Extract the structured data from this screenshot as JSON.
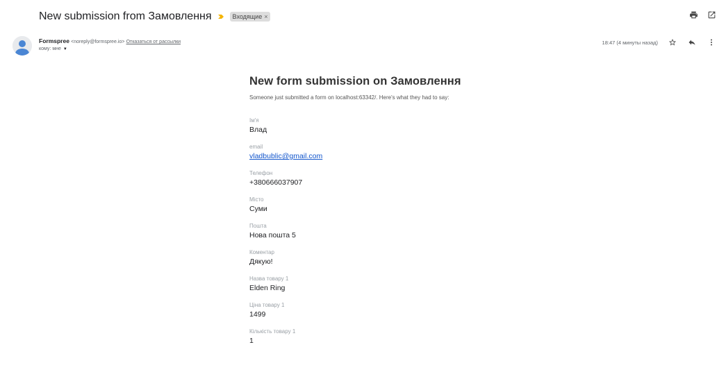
{
  "email": {
    "subject": "New submission from Замовлення",
    "label": "Входящие",
    "label_remove": "×",
    "sender_name": "Formspree",
    "sender_email": "<noreply@formspree.io>",
    "unsubscribe": "Отказаться от рассылки",
    "to": "кому: мне",
    "time": "18:47 (4 минуты назад)"
  },
  "content": {
    "title": "New form submission on Замовлення",
    "intro": "Someone just submitted a form on localhost:63342/. Here's what they had to say:",
    "fields": [
      {
        "label": "Ім'я",
        "value": "Влад"
      },
      {
        "label": "email",
        "value": "vladbublic@gmail.com"
      },
      {
        "label": "Телефон",
        "value": "+380666037907"
      },
      {
        "label": "Місто",
        "value": "Суми"
      },
      {
        "label": "Пошта",
        "value": "Нова пошта 5"
      },
      {
        "label": "Коментар",
        "value": "Дякую!"
      },
      {
        "label": "Назва товару 1",
        "value": "Elden Ring"
      },
      {
        "label": "Ціна товару 1",
        "value": "1499"
      },
      {
        "label": "Кількість товару 1",
        "value": "1"
      }
    ]
  },
  "icons": {
    "importance": "importance-marker-icon",
    "print": "print-icon",
    "open_new": "open-in-new-window-icon",
    "star": "star-icon",
    "reply": "reply-icon",
    "more": "more-vertical-icon",
    "avatar": "default-avatar-icon",
    "to_caret": "caret-down-icon"
  },
  "colors": {
    "importance": "#f4b400",
    "link": "#1155cc",
    "label_bg": "#dddddd"
  }
}
